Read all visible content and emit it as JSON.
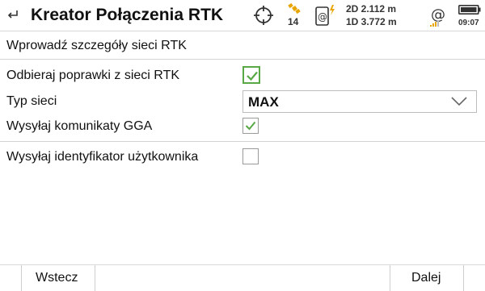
{
  "header": {
    "title": "Kreator Połączenia RTK",
    "satellites": "14",
    "precision_2d": "2D 2.112 m",
    "precision_1d": "1D 3.772 m",
    "time": "09:07",
    "accent_color": "#e8a400"
  },
  "form": {
    "section_title": "Wprowadź szczegóły sieci RTK",
    "receive_corrections": {
      "label": "Odbieraj poprawki z sieci RTK",
      "checked": true
    },
    "network_type": {
      "label": "Typ sieci",
      "value": "MAX"
    },
    "send_gga": {
      "label": "Wysyłaj komunikaty GGA",
      "checked": true
    },
    "send_user_id": {
      "label": "Wysyłaj identyfikator użytkownika",
      "checked": false
    }
  },
  "footer": {
    "back_label": "Wstecz",
    "next_label": "Dalej"
  },
  "colors": {
    "check": "#58a845"
  }
}
